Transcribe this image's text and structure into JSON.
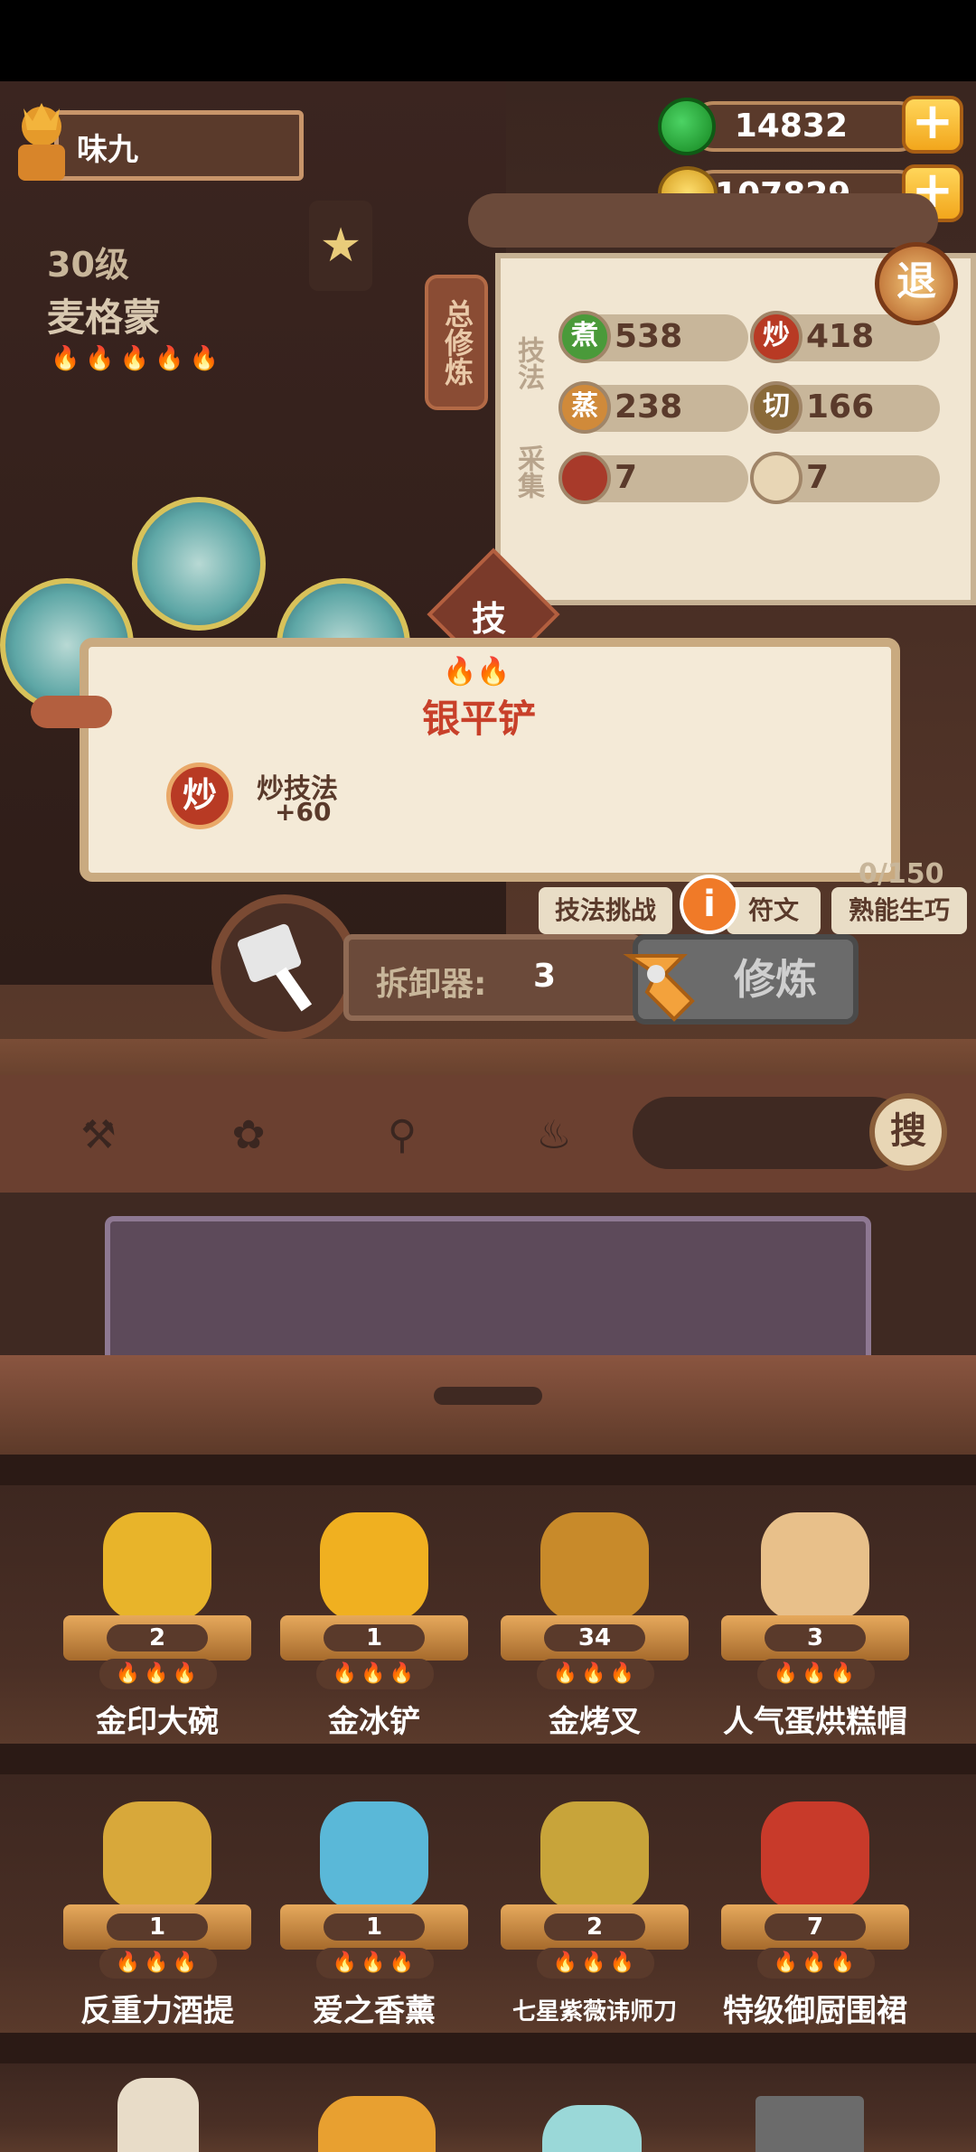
{
  "player": {
    "name": "味九"
  },
  "resources": {
    "jade": "14832",
    "coins": "1107829",
    "plus": "+"
  },
  "character": {
    "level": "30级",
    "name": "麦格蒙",
    "flames": "🔥🔥🔥🔥🔥"
  },
  "panel": {
    "tab": "总修炼",
    "section_skill": "技法",
    "section_gather": "采集",
    "skills": [
      {
        "icon": "煮",
        "value": "538",
        "color": "#4a9a3a"
      },
      {
        "icon": "炒",
        "value": "418",
        "color": "#b83a24"
      },
      {
        "icon": "蒸",
        "value": "238",
        "color": "#d08a3a"
      },
      {
        "icon": "切",
        "value": "166",
        "color": "#8a6a3a"
      }
    ],
    "gather": [
      {
        "value": "7"
      },
      {
        "value": "7"
      }
    ],
    "exit": "退",
    "ji_button": "技"
  },
  "popup": {
    "flames": "🔥🔥",
    "title": "银平铲",
    "skill_icon": "炒",
    "skill_name": "炒技法",
    "skill_value": "+60"
  },
  "actions": {
    "counter": "0/150",
    "challenge": "技法挑战",
    "rune": "符文",
    "proficiency": "熟能生巧",
    "dismantler_label": "拆卸器:",
    "dismantler_count": "3",
    "train": "修炼",
    "info": "i"
  },
  "search": {
    "button": "搜"
  },
  "items": [
    {
      "name": "金印大碗",
      "count": "2",
      "color": "#e8b42a"
    },
    {
      "name": "金冰铲",
      "count": "1",
      "color": "#f0b020"
    },
    {
      "name": "金烤叉",
      "count": "34",
      "color": "#c88a2a"
    },
    {
      "name": "人气蛋烘糕帽",
      "count": "3",
      "color": "#e8c08a"
    },
    {
      "name": "反重力酒提",
      "count": "1",
      "color": "#d8a83a"
    },
    {
      "name": "爱之香薰",
      "count": "1",
      "color": "#5ab8d8"
    },
    {
      "name": "七星紫薇讳师刀",
      "count": "2",
      "color": "#c8a43a"
    },
    {
      "name": "特级御厨围裙",
      "count": "7",
      "color": "#c83a2a"
    }
  ],
  "item_flames": "🔥🔥🔥"
}
